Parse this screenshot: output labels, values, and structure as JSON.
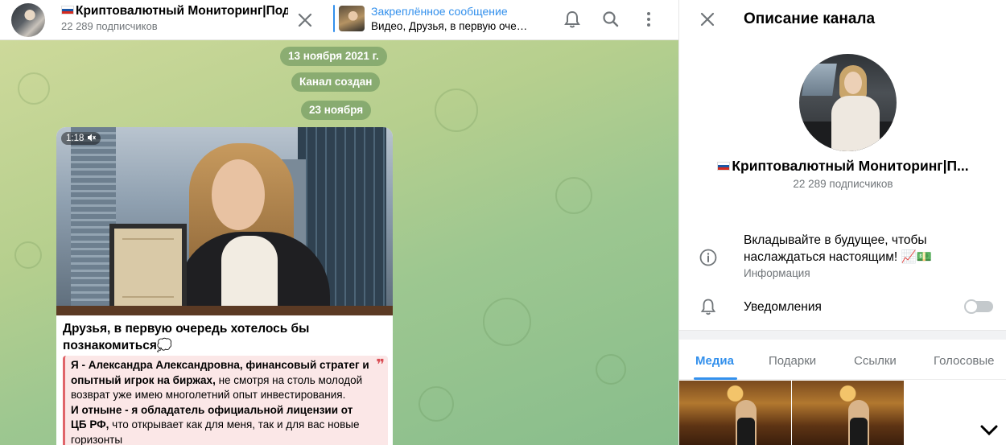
{
  "header": {
    "title": "Криптовалютный Мониторинг|Под",
    "subtitle": "22 289 подписчиков",
    "pinned": {
      "label": "Закреплённое сообщение",
      "text": "Видео, Друзья, в первую очередь хотелось бы познакомиться"
    },
    "icons": [
      "close-icon",
      "bell-icon",
      "search-icon",
      "more-vertical-icon"
    ]
  },
  "chat": {
    "service": [
      {
        "text": "13 ноября 2021 г."
      },
      {
        "text": "Канал создан"
      },
      {
        "text": "23 ноября"
      }
    ],
    "message": {
      "video_duration": "1:18",
      "video_muted_icon": "muted-speaker-icon",
      "text": "Друзья, в первую очередь хотелось бы познакомиться",
      "emoji": "💭",
      "quote": {
        "p1_bold": "Я -  Александра Александровна, финансовый стратег и опытный игрок на биржах,",
        "p1_rest": " не смотря на столь молодой возврат уже имею многолетний опыт инвестирования.",
        "p2_bold": "И отныне - я обладатель официальной лицензии от ЦБ РФ,",
        "p2_rest": " что открывает как для меня, так и для вас новые горизонты",
        "mark": "❞"
      }
    }
  },
  "panel": {
    "title": "Описание канала",
    "name": "Криптовалютный Мониторинг|П...",
    "subscribers": "22 289 подписчиков",
    "description": "Вкладывайте в будущее, чтобы наслаждаться настоящим! 📈💵",
    "description_label": "Информация",
    "notifications_label": "Уведомления",
    "notifications_on": false,
    "tabs": [
      "Медиа",
      "Подарки",
      "Ссылки",
      "Голосовые"
    ],
    "active_tab": "Медиа",
    "accent_color": "#3390ec"
  }
}
